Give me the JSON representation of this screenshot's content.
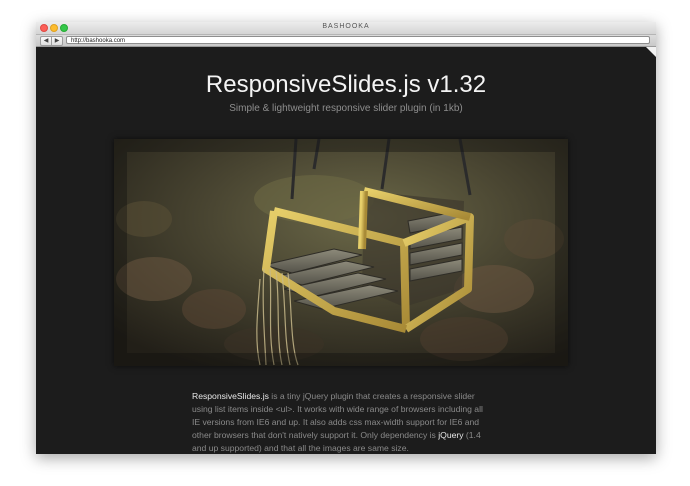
{
  "browser": {
    "window_title": "BASHOOKA",
    "back_label": "◀",
    "forward_label": "▶",
    "url": "http://bashooka.com"
  },
  "page": {
    "title": "ResponsiveSlides.js v1.32",
    "subtitle": "Simple & lightweight responsive slider plugin (in 1kb)",
    "slide_alt": "wooden swing hanging from chains",
    "description": {
      "p1_link": "ResponsiveSlides.js",
      "p1_text": " is a tiny jQuery plugin that creates a responsive slider using list items inside <ul>. It works with wide range of browsers including all IE versions from IE6 and up. It also adds css max-width support for IE6 and other browsers that don't natively support it. Only dependency is ",
      "p2_link": "jQuery",
      "p2_text": " (1.4 and up supported) and that all the images are same size."
    }
  },
  "colors": {
    "page_bg": "#1c1c1c",
    "heading": "#f4f4f4",
    "muted": "#8a8a8a"
  }
}
